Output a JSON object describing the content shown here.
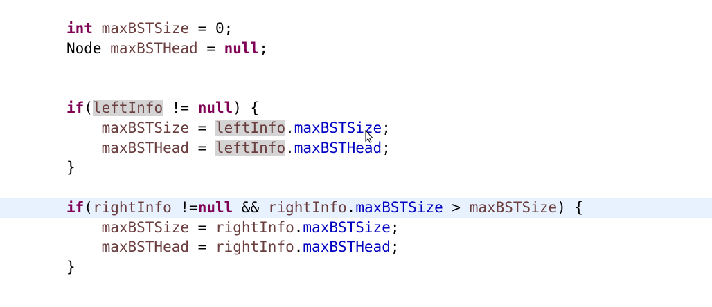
{
  "editor": {
    "language": "java",
    "colors": {
      "keyword": "#7f0055",
      "local_variable": "#6a3e3e",
      "field": "#0000c0",
      "occurrence_highlight": "#d4d4d4",
      "current_line": "#e8f2fe"
    },
    "lines": [
      {
        "tokens": [
          {
            "t": "int",
            "c": "kw"
          },
          {
            "t": " ",
            "c": "op"
          },
          {
            "t": "maxBSTSize",
            "c": "var"
          },
          {
            "t": " = 0;",
            "c": "op"
          }
        ]
      },
      {
        "tokens": [
          {
            "t": "Node",
            "c": "type"
          },
          {
            "t": " ",
            "c": "op"
          },
          {
            "t": "maxBSTHead",
            "c": "var"
          },
          {
            "t": " = ",
            "c": "op"
          },
          {
            "t": "null",
            "c": "kw"
          },
          {
            "t": ";",
            "c": "op"
          }
        ]
      },
      {
        "tokens": []
      },
      {
        "tokens": []
      },
      {
        "tokens": [
          {
            "t": "if",
            "c": "kw"
          },
          {
            "t": "(",
            "c": "op"
          },
          {
            "t": "leftInfo",
            "c": "var",
            "hl": true
          },
          {
            "t": " != ",
            "c": "op"
          },
          {
            "t": "null",
            "c": "kw"
          },
          {
            "t": ") {",
            "c": "op"
          }
        ]
      },
      {
        "tokens": [
          {
            "t": "    ",
            "c": "op"
          },
          {
            "t": "maxBSTSize",
            "c": "var"
          },
          {
            "t": " = ",
            "c": "op"
          },
          {
            "t": "leftInfo",
            "c": "var",
            "hl": true
          },
          {
            "t": ".",
            "c": "op"
          },
          {
            "t": "maxBSTSize",
            "c": "field"
          },
          {
            "t": ";",
            "c": "op"
          }
        ]
      },
      {
        "tokens": [
          {
            "t": "    ",
            "c": "op"
          },
          {
            "t": "maxBSTHead",
            "c": "var"
          },
          {
            "t": " = ",
            "c": "op"
          },
          {
            "t": "leftInfo",
            "c": "var",
            "hl": true
          },
          {
            "t": ".",
            "c": "op"
          },
          {
            "t": "maxBSTHead",
            "c": "field"
          },
          {
            "t": ";",
            "c": "op"
          }
        ]
      },
      {
        "tokens": [
          {
            "t": "}",
            "c": "op"
          }
        ]
      },
      {
        "tokens": []
      },
      {
        "current": true,
        "tokens": [
          {
            "t": "if",
            "c": "kw"
          },
          {
            "t": "(",
            "c": "op"
          },
          {
            "t": "rightInfo",
            "c": "var"
          },
          {
            "t": " !=",
            "c": "op"
          },
          {
            "t": "nu",
            "c": "kw"
          },
          {
            "caret": true
          },
          {
            "t": "ll",
            "c": "kw"
          },
          {
            "t": " && ",
            "c": "op"
          },
          {
            "t": "rightInfo",
            "c": "var"
          },
          {
            "t": ".",
            "c": "op"
          },
          {
            "t": "maxBSTSize",
            "c": "field"
          },
          {
            "t": " > ",
            "c": "op"
          },
          {
            "t": "maxBSTSize",
            "c": "var"
          },
          {
            "t": ") {",
            "c": "op"
          }
        ]
      },
      {
        "tokens": [
          {
            "t": "    ",
            "c": "op"
          },
          {
            "t": "maxBSTSize",
            "c": "var"
          },
          {
            "t": " = ",
            "c": "op"
          },
          {
            "t": "rightInfo",
            "c": "var"
          },
          {
            "t": ".",
            "c": "op"
          },
          {
            "t": "maxBSTSize",
            "c": "field"
          },
          {
            "t": ";",
            "c": "op"
          }
        ]
      },
      {
        "tokens": [
          {
            "t": "    ",
            "c": "op"
          },
          {
            "t": "maxBSTHead",
            "c": "var"
          },
          {
            "t": " = ",
            "c": "op"
          },
          {
            "t": "rightInfo",
            "c": "var"
          },
          {
            "t": ".",
            "c": "op"
          },
          {
            "t": "maxBSTHead",
            "c": "field"
          },
          {
            "t": ";",
            "c": "op"
          }
        ]
      },
      {
        "tokens": [
          {
            "t": "}",
            "c": "op"
          }
        ]
      }
    ]
  }
}
